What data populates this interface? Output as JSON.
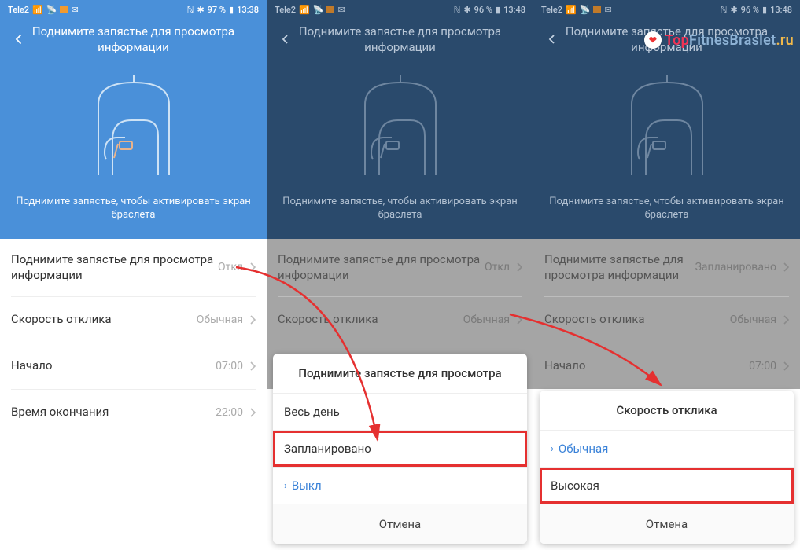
{
  "status": {
    "carrier": "Tele2",
    "nfc_icon": "ℕ",
    "bt_icon": "✱",
    "battery1": "97 %",
    "battery2": "96 %",
    "battery3": "96 %",
    "time1": "13:38",
    "time2": "13:48",
    "time3": "13:48"
  },
  "header": {
    "title": "Поднимите запястье для просмотра информации"
  },
  "hero": {
    "caption": "Поднимите запястье, чтобы активировать экран браслета"
  },
  "rows": {
    "raise_label": "Поднимите запястье для просмотра информации",
    "raise_value1": "Откл",
    "raise_value2": "Откл",
    "raise_value3": "Запланировано",
    "speed_label": "Скорость отклика",
    "speed_value": "Обычная",
    "start_label": "Начало",
    "start_value": "07:00",
    "end_label": "Время окончания",
    "end_value": "22:00"
  },
  "sheet_raise": {
    "title": "Поднимите запястье для просмотра",
    "opt_allday": "Весь день",
    "opt_scheduled": "Запланировано",
    "opt_off": "Выкл",
    "cancel": "Отмена"
  },
  "sheet_speed": {
    "title": "Скорость отклика",
    "opt_normal": "Обычная",
    "opt_high": "Высокая",
    "cancel": "Отмена"
  },
  "watermark": {
    "pre": "T",
    "top": "op",
    "mid": "FitnesBraslet",
    "ru": ".ru"
  }
}
